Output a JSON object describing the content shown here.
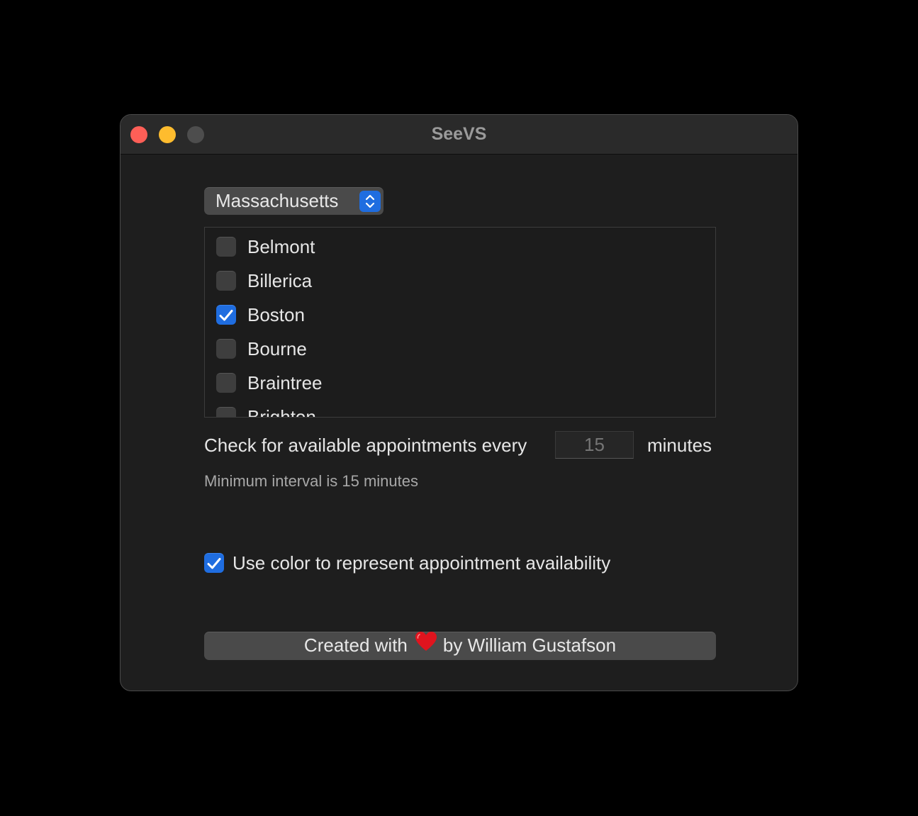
{
  "window": {
    "title": "SeeVS"
  },
  "state_selector": {
    "selected": "Massachusetts",
    "icon": "chevron-updown-icon"
  },
  "locations": [
    {
      "label": "Belmont",
      "checked": false
    },
    {
      "label": "Billerica",
      "checked": false
    },
    {
      "label": "Boston",
      "checked": true
    },
    {
      "label": "Bourne",
      "checked": false
    },
    {
      "label": "Braintree",
      "checked": false
    },
    {
      "label": "Brighton",
      "checked": false
    }
  ],
  "interval": {
    "label": "Check for available appointments every",
    "placeholder": "15",
    "unit": "minutes",
    "hint": "Minimum interval is 15 minutes"
  },
  "color_option": {
    "label": "Use color to represent appointment availability",
    "checked": true
  },
  "credit": {
    "prefix": "Created with",
    "icon": "heart-icon",
    "suffix": "by William Gustafson"
  },
  "colors": {
    "accent": "#1f6de0",
    "close": "#fe5f57",
    "minimize": "#febc2e",
    "heart": "#e0141e"
  }
}
